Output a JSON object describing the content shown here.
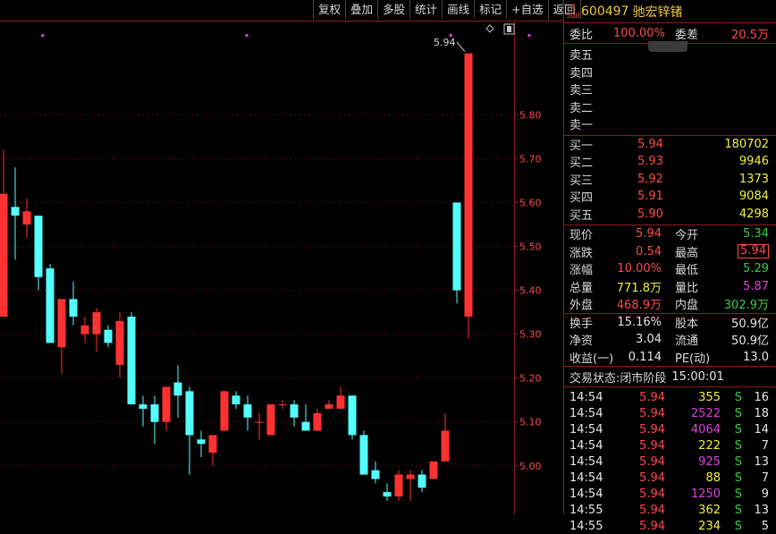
{
  "toolbar": [
    "复权",
    "叠加",
    "多股",
    "统计",
    "画线",
    "标记",
    "+自选",
    "返回"
  ],
  "stock": {
    "badge_r": "R",
    "badge_num": "500",
    "code": "600497",
    "name": "驰宏锌锗"
  },
  "weibi": {
    "label": "委比",
    "value": "100.00%",
    "label2": "委差",
    "value2": "20.5万"
  },
  "sell": [
    {
      "label": "卖五"
    },
    {
      "label": "卖四"
    },
    {
      "label": "卖三"
    },
    {
      "label": "卖二"
    },
    {
      "label": "卖一"
    }
  ],
  "buy": [
    {
      "label": "买一",
      "price": "5.94",
      "vol": "180702"
    },
    {
      "label": "买二",
      "price": "5.93",
      "vol": "9946"
    },
    {
      "label": "买三",
      "price": "5.92",
      "vol": "1373"
    },
    {
      "label": "买四",
      "price": "5.91",
      "vol": "9084"
    },
    {
      "label": "买五",
      "price": "5.90",
      "vol": "4298"
    }
  ],
  "quote": [
    {
      "l1": "现价",
      "v1": "5.94",
      "c1": "red",
      "l2": "今开",
      "v2": "5.34",
      "c2": "green"
    },
    {
      "l1": "涨跌",
      "v1": "0.54",
      "c1": "red",
      "l2": "最高",
      "v2": "5.94",
      "c2": "red",
      "boxed": true
    },
    {
      "l1": "涨幅",
      "v1": "10.00%",
      "c1": "red",
      "l2": "最低",
      "v2": "5.29",
      "c2": "green"
    },
    {
      "l1": "总量",
      "v1": "771.8万",
      "c1": "yellow",
      "l2": "量比",
      "v2": "5.87",
      "c2": "magenta"
    },
    {
      "l1": "外盘",
      "v1": "468.9万",
      "c1": "red",
      "l2": "内盘",
      "v2": "302.9万",
      "c2": "green"
    }
  ],
  "fund": [
    {
      "l1": "换手",
      "v1": "15.16%",
      "l2": "股本",
      "v2": "50.9亿"
    },
    {
      "l1": "净资",
      "v1": "3.04",
      "l2": "流通",
      "v2": "50.9亿"
    },
    {
      "l1": "收益(一)",
      "v1": "0.114",
      "l2": "PE(动)",
      "v2": "13.0"
    }
  ],
  "status": {
    "label": "交易状态:",
    "value": "闭市阶段",
    "time": "15:00:01"
  },
  "ticks": [
    {
      "time": "14:54",
      "price": "5.94",
      "vol": "355",
      "vc": "yellow",
      "bs": "S",
      "n": "16"
    },
    {
      "time": "14:54",
      "price": "5.94",
      "vol": "2522",
      "vc": "magenta",
      "bs": "S",
      "n": "18"
    },
    {
      "time": "14:54",
      "price": "5.94",
      "vol": "4064",
      "vc": "magenta",
      "bs": "S",
      "n": "14"
    },
    {
      "time": "14:54",
      "price": "5.94",
      "vol": "222",
      "vc": "yellow",
      "bs": "S",
      "n": "7"
    },
    {
      "time": "14:54",
      "price": "5.94",
      "vol": "925",
      "vc": "magenta",
      "bs": "S",
      "n": "13"
    },
    {
      "time": "14:54",
      "price": "5.94",
      "vol": "88",
      "vc": "yellow",
      "bs": "S",
      "n": "7"
    },
    {
      "time": "14:54",
      "price": "5.94",
      "vol": "1250",
      "vc": "magenta",
      "bs": "S",
      "n": "9"
    },
    {
      "time": "14:55",
      "price": "5.94",
      "vol": "362",
      "vc": "yellow",
      "bs": "S",
      "n": "13"
    },
    {
      "time": "14:55",
      "price": "5.94",
      "vol": "234",
      "vc": "yellow",
      "bs": "S",
      "n": "5"
    }
  ],
  "chart_data": {
    "type": "candlestick",
    "y_ticks": [
      "5.80",
      "5.70",
      "5.60",
      "5.50",
      "5.40",
      "5.30",
      "5.20",
      "5.10",
      "5.00"
    ],
    "ylim": [
      4.92,
      5.98
    ],
    "last_price_label": "5.94",
    "colors": {
      "up": "#ff3232",
      "down": "#54ffff",
      "grid": "#8a1d1d",
      "marker": "#e040e0"
    },
    "candles": [
      {
        "o": 5.34,
        "h": 5.72,
        "l": 5.34,
        "c": 5.62
      },
      {
        "o": 5.59,
        "h": 5.68,
        "l": 5.47,
        "c": 5.57
      },
      {
        "o": 5.55,
        "h": 5.61,
        "l": 5.52,
        "c": 5.58
      },
      {
        "o": 5.57,
        "h": 5.57,
        "l": 5.4,
        "c": 5.43
      },
      {
        "o": 5.45,
        "h": 5.46,
        "l": 5.3,
        "c": 5.28
      },
      {
        "o": 5.27,
        "h": 5.37,
        "l": 5.21,
        "c": 5.38
      },
      {
        "o": 5.38,
        "h": 5.42,
        "l": 5.32,
        "c": 5.34
      },
      {
        "o": 5.3,
        "h": 5.34,
        "l": 5.28,
        "c": 5.32
      },
      {
        "o": 5.3,
        "h": 5.36,
        "l": 5.26,
        "c": 5.35
      },
      {
        "o": 5.31,
        "h": 5.32,
        "l": 5.27,
        "c": 5.28
      },
      {
        "o": 5.23,
        "h": 5.35,
        "l": 5.2,
        "c": 5.33
      },
      {
        "o": 5.34,
        "h": 5.35,
        "l": 5.15,
        "c": 5.14
      },
      {
        "o": 5.14,
        "h": 5.16,
        "l": 5.09,
        "c": 5.13
      },
      {
        "o": 5.14,
        "h": 5.16,
        "l": 5.05,
        "c": 5.1
      },
      {
        "o": 5.1,
        "h": 5.17,
        "l": 5.08,
        "c": 5.18
      },
      {
        "o": 5.19,
        "h": 5.23,
        "l": 5.11,
        "c": 5.16
      },
      {
        "o": 5.17,
        "h": 5.18,
        "l": 4.98,
        "c": 5.07
      },
      {
        "o": 5.06,
        "h": 5.08,
        "l": 5.02,
        "c": 5.05
      },
      {
        "o": 5.03,
        "h": 5.07,
        "l": 5.0,
        "c": 5.07
      },
      {
        "o": 5.08,
        "h": 5.17,
        "l": 5.08,
        "c": 5.17
      },
      {
        "o": 5.16,
        "h": 5.17,
        "l": 5.13,
        "c": 5.14
      },
      {
        "o": 5.14,
        "h": 5.16,
        "l": 5.08,
        "c": 5.11
      },
      {
        "o": 5.1,
        "h": 5.12,
        "l": 5.06,
        "c": 5.1
      },
      {
        "o": 5.07,
        "h": 5.13,
        "l": 5.07,
        "c": 5.14
      },
      {
        "o": 5.14,
        "h": 5.15,
        "l": 5.13,
        "c": 5.14
      },
      {
        "o": 5.14,
        "h": 5.15,
        "l": 5.09,
        "c": 5.11
      },
      {
        "o": 5.1,
        "h": 5.14,
        "l": 5.08,
        "c": 5.08
      },
      {
        "o": 5.08,
        "h": 5.13,
        "l": 5.08,
        "c": 5.12
      },
      {
        "o": 5.13,
        "h": 5.15,
        "l": 5.13,
        "c": 5.14
      },
      {
        "o": 5.13,
        "h": 5.18,
        "l": 5.13,
        "c": 5.16
      },
      {
        "o": 5.16,
        "h": 5.16,
        "l": 5.06,
        "c": 5.07
      },
      {
        "o": 5.07,
        "h": 5.08,
        "l": 4.98,
        "c": 4.98
      },
      {
        "o": 4.99,
        "h": 5.01,
        "l": 4.96,
        "c": 4.97
      },
      {
        "o": 4.94,
        "h": 4.96,
        "l": 4.92,
        "c": 4.93
      },
      {
        "o": 4.93,
        "h": 4.99,
        "l": 4.92,
        "c": 4.98
      },
      {
        "o": 4.97,
        "h": 4.99,
        "l": 4.92,
        "c": 4.98
      },
      {
        "o": 4.98,
        "h": 4.99,
        "l": 4.94,
        "c": 4.95
      },
      {
        "o": 4.97,
        "h": 5.01,
        "l": 4.97,
        "c": 5.01
      },
      {
        "o": 5.01,
        "h": 5.12,
        "l": 5.01,
        "c": 5.08
      },
      {
        "o": 5.6,
        "h": 5.6,
        "l": 5.37,
        "c": 5.4
      },
      {
        "o": 5.34,
        "h": 5.94,
        "l": 5.29,
        "c": 5.94
      }
    ],
    "markers": [
      2,
      15,
      28,
      33,
      40
    ]
  }
}
